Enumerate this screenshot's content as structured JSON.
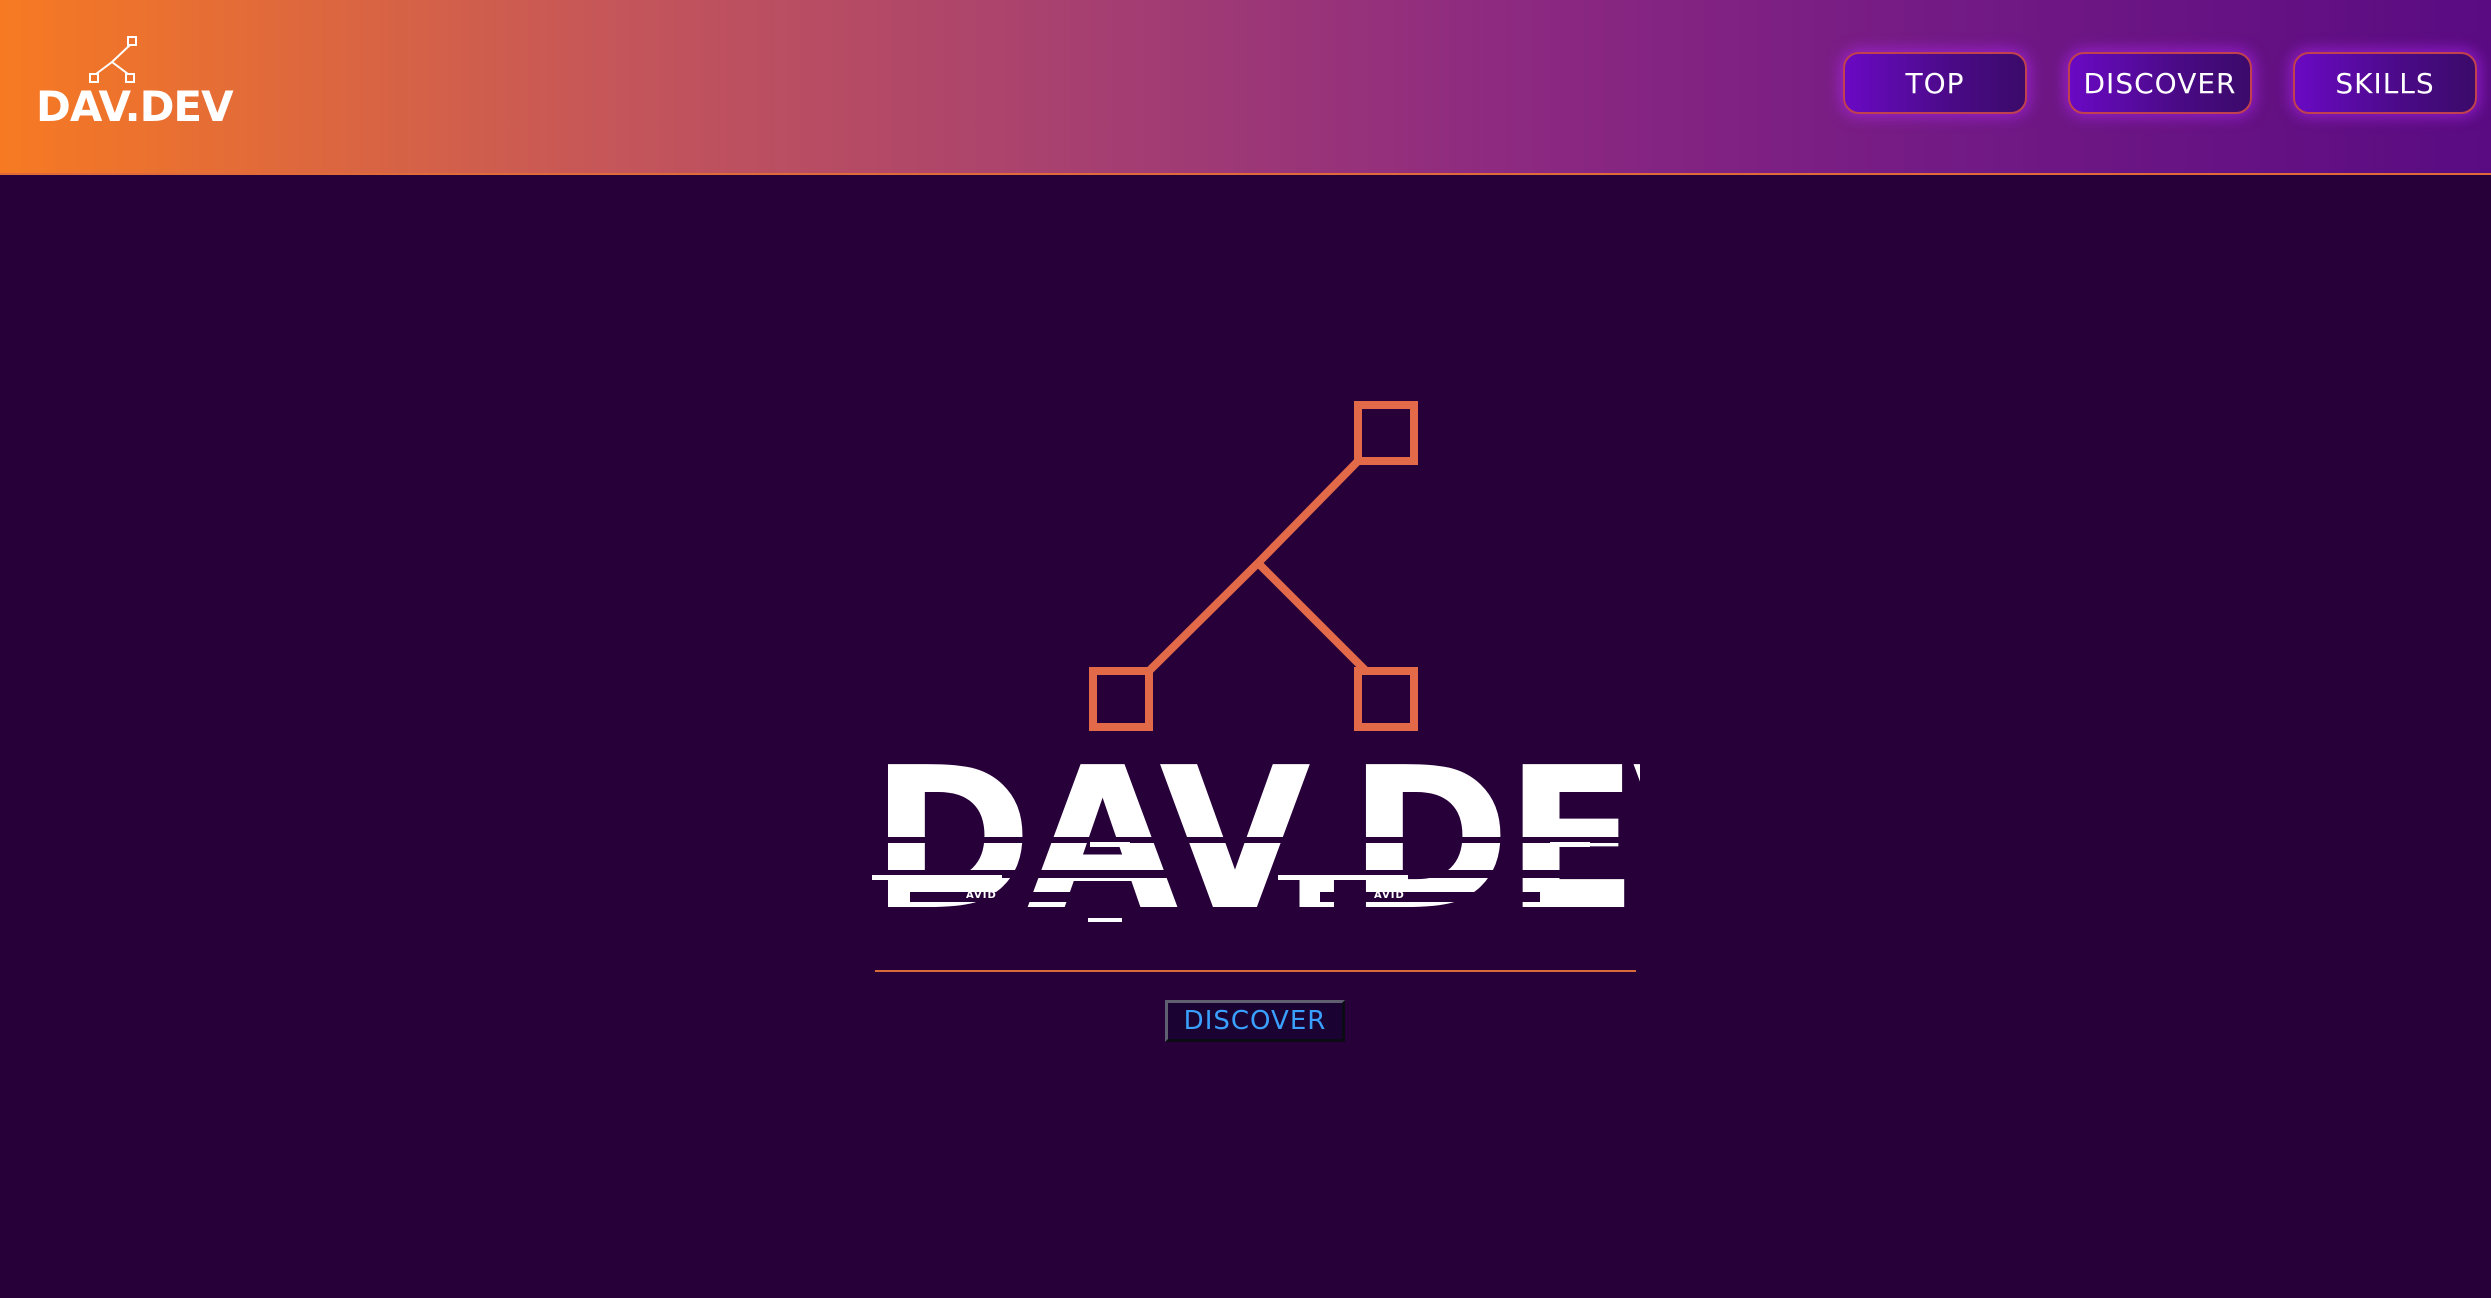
{
  "header": {
    "logo_text": "DAV.DEV",
    "logo_icon": "node-tree-icon",
    "nav": [
      {
        "label": "TOP"
      },
      {
        "label": "DISCOVER"
      },
      {
        "label": "SKILLS"
      }
    ]
  },
  "hero": {
    "logo_icon": "node-tree-icon",
    "title": "DAV.DEV",
    "glitch_labels": [
      "AVID",
      "AVID"
    ],
    "cta_label": "DISCOVER"
  },
  "colors": {
    "background": "#27003a",
    "accent": "#e26a48",
    "header_gradient_start": "#f77a22",
    "header_gradient_end": "#5a0b82",
    "cta_text": "#3aa0ff"
  }
}
